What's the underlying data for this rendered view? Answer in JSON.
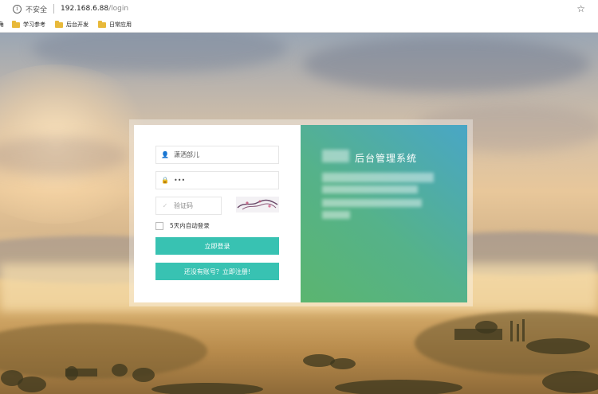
{
  "browser": {
    "security_label": "不安全",
    "url_host": "192.168.6.88",
    "url_path": "/login",
    "bookmark_truncated": "角",
    "bookmarks": [
      {
        "label": "学习参考"
      },
      {
        "label": "后台开发"
      },
      {
        "label": "日常应用"
      }
    ]
  },
  "login": {
    "username_value": "潇洒部儿",
    "password_value": "•••",
    "captcha_placeholder": "验证码",
    "remember_label": "5天内自动登录",
    "login_button": "立即登录",
    "register_button": "还没有账号？立即注册!"
  },
  "brand": {
    "title": "后台管理系统"
  },
  "colors": {
    "accent": "#38c2b2",
    "panel_gradient_start": "#5bb56f",
    "panel_gradient_end": "#49a6c6"
  }
}
